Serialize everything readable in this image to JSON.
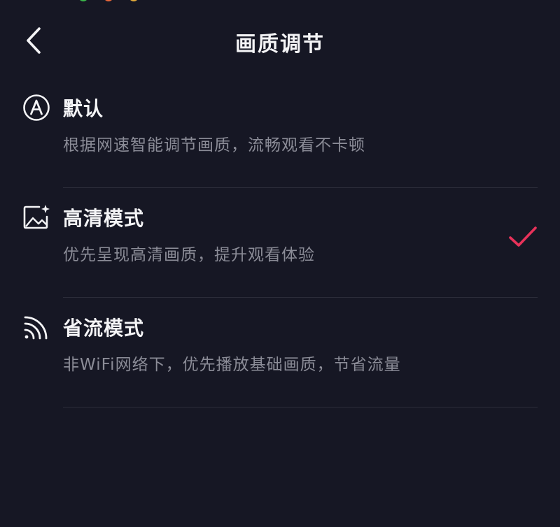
{
  "header": {
    "title": "画质调节",
    "back_icon": "chevron-left-icon"
  },
  "options": [
    {
      "id": "default",
      "icon": "auto-a-icon",
      "title": "默认",
      "description": "根据网速智能调节画质，流畅观看不卡顿",
      "selected": false
    },
    {
      "id": "hd",
      "icon": "hd-image-icon",
      "title": "高清模式",
      "description": "优先呈现高清画质，提升观看体验",
      "selected": true
    },
    {
      "id": "data-saver",
      "icon": "signal-wave-icon",
      "title": "省流模式",
      "description": "非WiFi网络下，优先播放基础画质，节省流量",
      "selected": false
    }
  ],
  "colors": {
    "background": "#161724",
    "title_text": "#f4f4f6",
    "description_text": "#8b8c97",
    "divider": "#2c2d3a",
    "check_accent": "#e8325a"
  }
}
